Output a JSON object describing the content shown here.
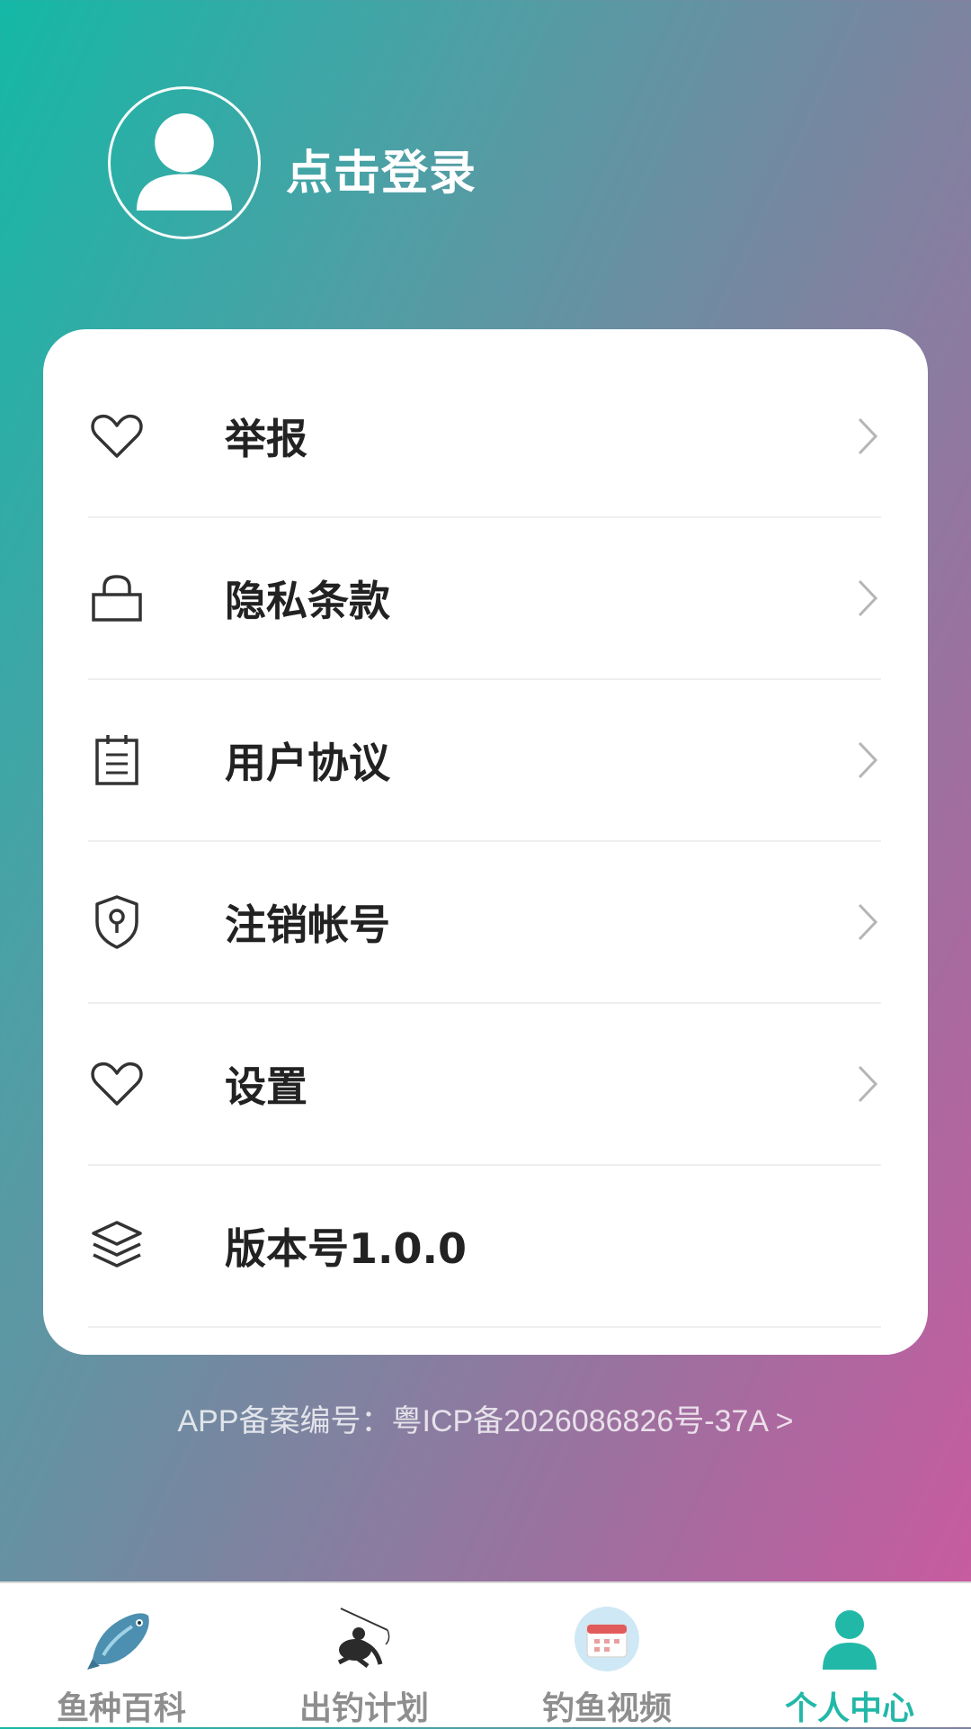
{
  "header": {
    "login_text": "点击登录",
    "avatar_icon": "user-avatar-icon"
  },
  "menu": {
    "items": [
      {
        "label": "举报",
        "icon": "heart-icon",
        "has_chevron": true
      },
      {
        "label": "隐私条款",
        "icon": "lock-icon",
        "has_chevron": true
      },
      {
        "label": "用户协议",
        "icon": "clipboard-icon",
        "has_chevron": true
      },
      {
        "label": "注销帐号",
        "icon": "shield-icon",
        "has_chevron": true
      },
      {
        "label": "设置",
        "icon": "heart-icon",
        "has_chevron": true
      },
      {
        "label": "版本号1.0.0",
        "icon": "layers-icon",
        "has_chevron": false
      }
    ]
  },
  "footer": {
    "icp_text": "APP备案编号：粤ICP备2026086826号-37A >"
  },
  "tabbar": {
    "tabs": [
      {
        "label": "鱼种百科",
        "icon": "fish-icon",
        "active": false
      },
      {
        "label": "出钓计划",
        "icon": "angler-icon",
        "active": false
      },
      {
        "label": "钓鱼视频",
        "icon": "calendar-icon",
        "active": false
      },
      {
        "label": "个人中心",
        "icon": "person-icon",
        "active": true
      }
    ]
  },
  "colors": {
    "gradient_start": "#14b8a6",
    "gradient_end": "#cf58a0",
    "active_tab": "#22b8a8",
    "inactive_tab": "#8e8e8e",
    "menu_text": "#222222"
  }
}
